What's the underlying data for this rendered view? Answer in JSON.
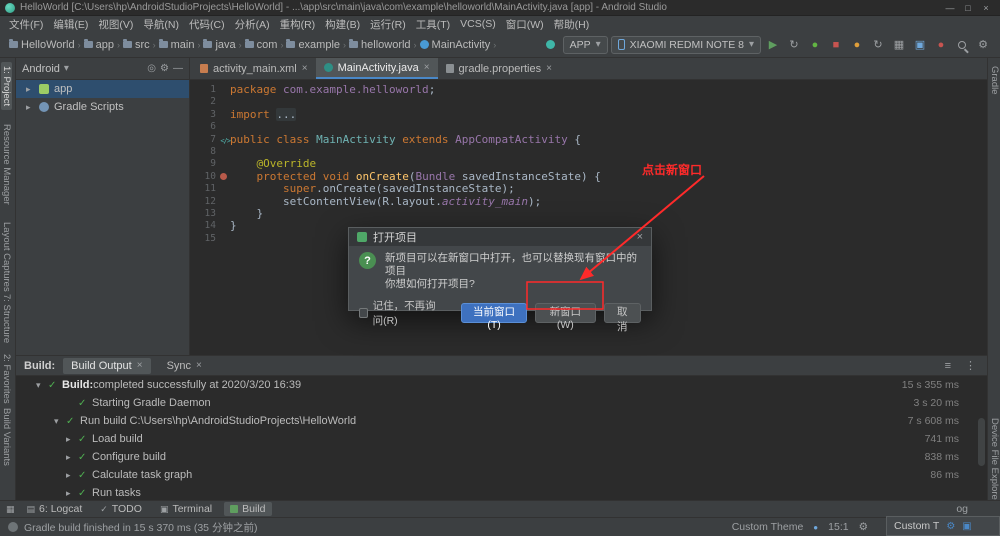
{
  "window": {
    "title": "HelloWorld [C:\\Users\\hp\\AndroidStudioProjects\\HelloWorld] - ...\\app\\src\\main\\java\\com\\example\\helloworld\\MainActivity.java [app] - Android Studio",
    "minimize": "—",
    "maximize": "□",
    "close": "×"
  },
  "menu": {
    "items": [
      "文件(F)",
      "编辑(E)",
      "视图(V)",
      "导航(N)",
      "代码(C)",
      "分析(A)",
      "重构(R)",
      "构建(B)",
      "运行(R)",
      "工具(T)",
      "VCS(S)",
      "窗口(W)",
      "帮助(H)"
    ]
  },
  "toolbar": {
    "breadcrumbs": [
      "HelloWorld",
      "app",
      "src",
      "main",
      "java",
      "com",
      "example",
      "helloworld",
      "MainActivity"
    ],
    "run_config": "APP",
    "device": "XIAOMI REDMI NOTE 8"
  },
  "tool_strips": {
    "left": [
      "1: Project",
      "Resource Manager",
      "Layout Captures",
      "7: Structure",
      "2: Favorites",
      "Build Variants"
    ],
    "right": [
      "Gradle",
      "Device File Explorer"
    ]
  },
  "project_panel": {
    "view_selector": "Android",
    "items": [
      {
        "label": "app"
      },
      {
        "label": "Gradle Scripts"
      }
    ]
  },
  "editor": {
    "tabs": [
      {
        "label": "activity_main.xml"
      },
      {
        "label": "MainActivity.java"
      },
      {
        "label": "gradle.properties"
      }
    ],
    "lines": [
      {
        "num": "1",
        "t0": "package ",
        "t1": "com.example.helloworld",
        "t2": ";"
      },
      {
        "num": "2"
      },
      {
        "num": "3",
        "t0": "import ",
        "t1": "..."
      },
      {
        "num": "6"
      },
      {
        "num": "7",
        "t0": "public class ",
        "t1": "MainActivity ",
        "t2": "extends ",
        "t3": "AppCompatActivity ",
        "t4": "{"
      },
      {
        "num": "8"
      },
      {
        "num": "9",
        "t0": "    ",
        "t1": "@Override"
      },
      {
        "num": "10",
        "t0": "    ",
        "t1": "protected void ",
        "t2": "onCreate",
        "t3": "(",
        "t4": "Bundle",
        "t5": " savedInstanceState) {"
      },
      {
        "num": "11",
        "t0": "        ",
        "t1": "super",
        "t2": ".onCreate(savedInstanceState);"
      },
      {
        "num": "12",
        "t0": "        setContentView(R.layout.",
        "t1": "activity_main",
        "t2": ");"
      },
      {
        "num": "13",
        "t0": "    }"
      },
      {
        "num": "14",
        "t0": "}"
      },
      {
        "num": "15"
      }
    ]
  },
  "annotation": {
    "label": "点击新窗口",
    "color": "#ff2a2a"
  },
  "dialog": {
    "title": "打开项目",
    "message_line1": "新项目可以在新窗口中打开，也可以替换现有窗口中的项目",
    "message_line2": "你想如何打开项目?",
    "checkbox_label": "记住，不再询问(R)",
    "buttons": {
      "current_window": "当前窗口(T)",
      "new_window": "新窗口(W)",
      "cancel": "取消"
    }
  },
  "build_panel": {
    "label": "Build:",
    "tabs": [
      "Build Output",
      "Sync"
    ],
    "rows": [
      {
        "strong": "Build:",
        "label": " completed successfully at 2020/3/20 16:39",
        "time": "15 s 355 ms"
      },
      {
        "label": "Starting Gradle Daemon",
        "time": "3 s 20 ms"
      },
      {
        "label": "Run build C:\\Users\\hp\\AndroidStudioProjects\\HelloWorld",
        "time": "7 s 608 ms"
      },
      {
        "label": "Load build",
        "time": "741 ms"
      },
      {
        "label": "Configure build",
        "time": "838 ms"
      },
      {
        "label": "Calculate task graph",
        "time": "86 ms"
      },
      {
        "label": "Run tasks",
        "time": ""
      }
    ]
  },
  "tool_buttons": {
    "items": [
      "6: Logcat",
      "TODO",
      "Terminal",
      "Build"
    ],
    "partial_right": "og"
  },
  "status_bar": {
    "message": "Gradle build finished in 15 s 370 ms (35 分钟之前)",
    "theme": "Custom Theme",
    "caret": "15:1",
    "popup_label": "Custom T"
  },
  "icons": {
    "close": "×",
    "chevron_down": "▾",
    "chevron_right": "▸",
    "chevron_sep": "›",
    "check": "✓",
    "play": "▶",
    "stop": "■",
    "gear": "⚙",
    "sync": "↻",
    "grid": "▦",
    "menu": "≡",
    "more": "⋮",
    "min": "—",
    "max": "□",
    "screen": "▣",
    "list": "▤",
    "dot": "●",
    "target": "◎",
    "code": "</>"
  },
  "colors": {
    "accent_blue": "#4a88c7",
    "annotation_red": "#ff2a2a",
    "success_green": "#4fae51",
    "primary_button": "#3e71bf"
  }
}
